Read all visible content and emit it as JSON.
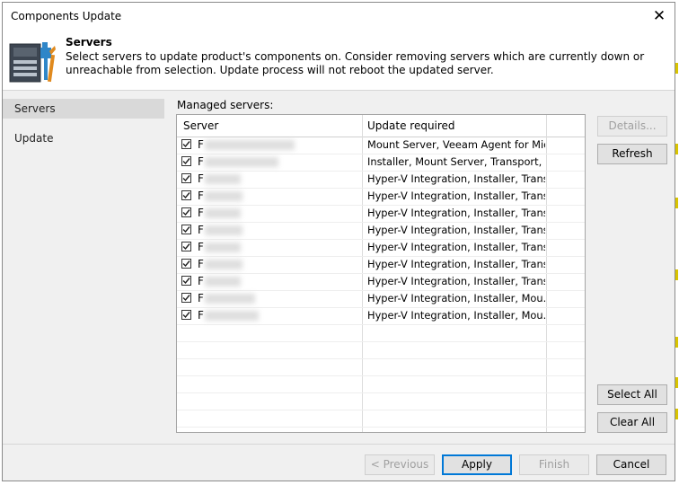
{
  "window": {
    "title": "Components Update"
  },
  "header": {
    "title": "Servers",
    "description": "Select servers to update product's components on. Consider removing servers which are currently down or unreachable from selection. Update process will not reboot the updated server."
  },
  "sidebar": {
    "items": [
      {
        "label": "Servers",
        "active": true
      },
      {
        "label": "Update",
        "active": false
      }
    ]
  },
  "main": {
    "managed_label": "Managed servers:",
    "columns": {
      "server": "Server",
      "update_required": "Update required"
    },
    "rows": [
      {
        "checked": true,
        "server": "F",
        "update": "Mount Server, Veeam Agent for Mic..."
      },
      {
        "checked": true,
        "server": "F",
        "update": "Installer, Mount Server, Transport, V..."
      },
      {
        "checked": true,
        "server": "F",
        "update": "Hyper-V Integration, Installer, Trans..."
      },
      {
        "checked": true,
        "server": "F",
        "update": "Hyper-V Integration, Installer, Trans..."
      },
      {
        "checked": true,
        "server": "F",
        "update": "Hyper-V Integration, Installer, Trans..."
      },
      {
        "checked": true,
        "server": "F",
        "update": "Hyper-V Integration, Installer, Trans..."
      },
      {
        "checked": true,
        "server": "F",
        "update": "Hyper-V Integration, Installer, Trans..."
      },
      {
        "checked": true,
        "server": "F",
        "update": "Hyper-V Integration, Installer, Trans..."
      },
      {
        "checked": true,
        "server": "F",
        "update": "Hyper-V Integration, Installer, Trans..."
      },
      {
        "checked": true,
        "server": "F",
        "update": "Hyper-V Integration, Installer, Mou..."
      },
      {
        "checked": true,
        "server": "F",
        "update": "Hyper-V Integration, Installer, Mou..."
      }
    ]
  },
  "side_buttons": {
    "details": "Details...",
    "refresh": "Refresh",
    "select_all": "Select All",
    "clear_all": "Clear All"
  },
  "footer": {
    "previous": "< Previous",
    "apply": "Apply",
    "finish": "Finish",
    "cancel": "Cancel"
  },
  "icons": {
    "header": "server-update-tools-icon",
    "close": "close-icon",
    "checkbox": "checkmark-icon"
  },
  "colors": {
    "accent": "#0078d7",
    "sidebar_bg": "#f0f0f0",
    "active_item": "#d9d9d9"
  }
}
